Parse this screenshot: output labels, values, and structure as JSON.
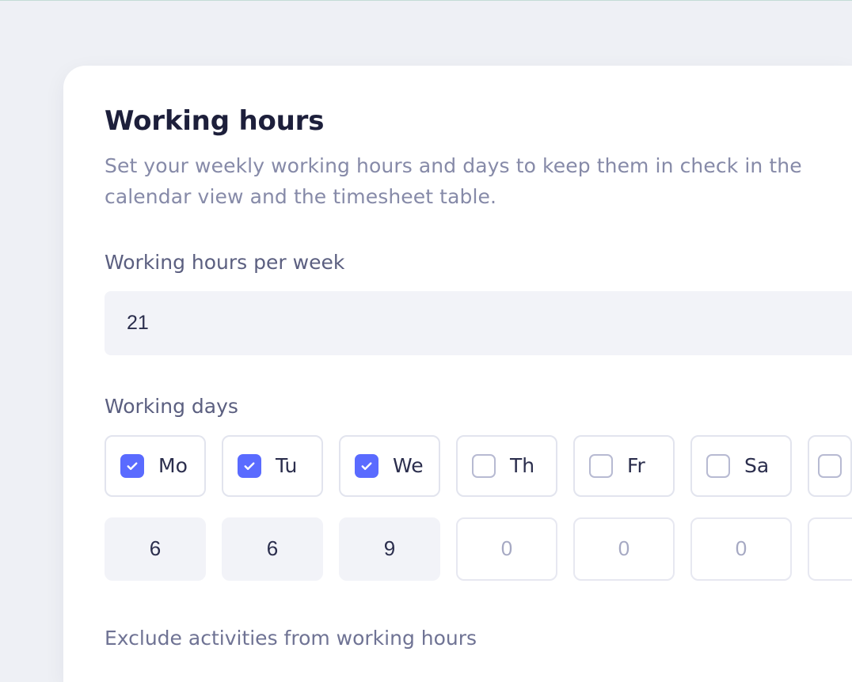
{
  "section": {
    "title": "Working hours",
    "description": "Set your weekly working hours and days to keep them in check in the calendar view and the timesheet table."
  },
  "per_week": {
    "label": "Working hours per week",
    "value": "21"
  },
  "working_days": {
    "label": "Working days",
    "days": [
      {
        "abbr": "Mo",
        "checked": true,
        "hours": "6"
      },
      {
        "abbr": "Tu",
        "checked": true,
        "hours": "6"
      },
      {
        "abbr": "We",
        "checked": true,
        "hours": "9"
      },
      {
        "abbr": "Th",
        "checked": false,
        "hours": "0"
      },
      {
        "abbr": "Fr",
        "checked": false,
        "hours": "0"
      },
      {
        "abbr": "Sa",
        "checked": false,
        "hours": "0"
      }
    ],
    "trailing_day": {
      "checked": false,
      "hours": ""
    }
  },
  "exclude": {
    "label": "Exclude activities from working hours"
  }
}
